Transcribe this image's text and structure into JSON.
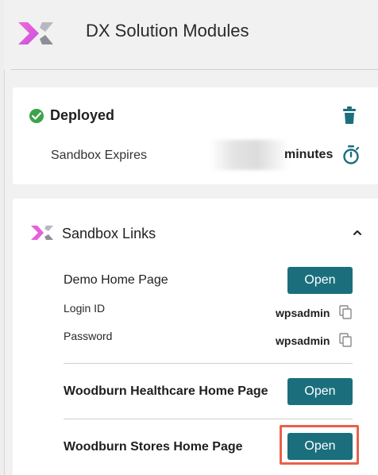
{
  "header": {
    "title": "DX Solution Modules"
  },
  "status": {
    "label": "Deployed",
    "expires_label": "Sandbox Expires",
    "expires_unit": "minutes"
  },
  "sandbox_links": {
    "title": "Sandbox Links",
    "items": [
      {
        "label": "Demo Home Page",
        "button": "Open",
        "login_label": "Login ID",
        "login_value": "wpsadmin",
        "password_label": "Password",
        "password_value": "wpsadmin"
      },
      {
        "label": "Woodburn Healthcare Home Page",
        "button": "Open"
      },
      {
        "label": "Woodburn Stores Home Page",
        "button": "Open"
      }
    ]
  },
  "colors": {
    "accent": "#1b6f7d",
    "success": "#3ca34a",
    "highlight": "#e8604c",
    "logo_pink": "#e85fd8"
  }
}
